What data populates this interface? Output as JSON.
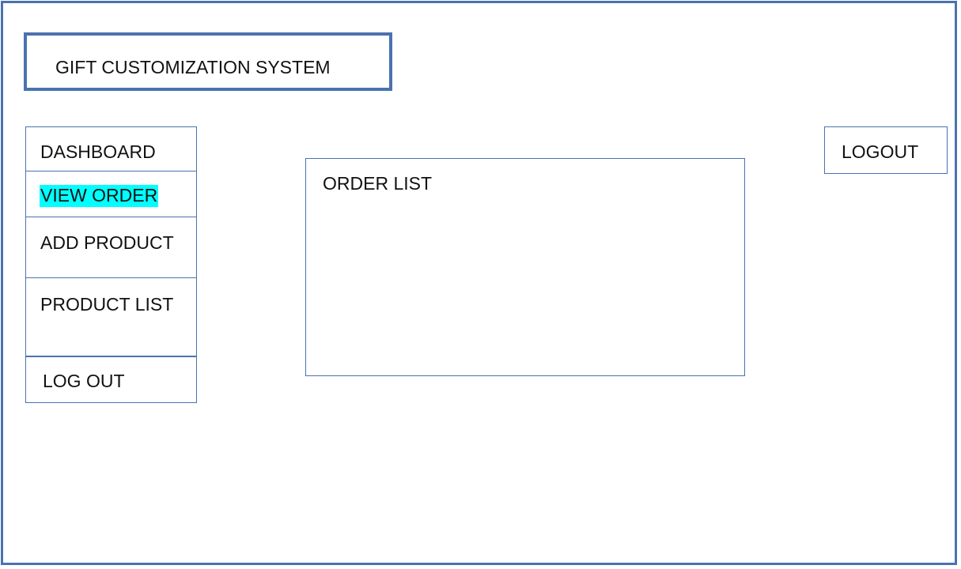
{
  "header": {
    "title": "GIFT CUSTOMIZATION SYSTEM"
  },
  "sidebar": {
    "items": [
      {
        "label": "DASHBOARD",
        "active": false
      },
      {
        "label": "VIEW ORDER",
        "active": true
      },
      {
        "label": "ADD PRODUCT",
        "active": false
      },
      {
        "label": "PRODUCT LIST",
        "active": false
      },
      {
        "label": "LOG OUT",
        "active": false
      }
    ]
  },
  "main": {
    "panel_title": "ORDER LIST"
  },
  "topbar": {
    "logout_label": "LOGOUT"
  },
  "colors": {
    "border": "#4a72b0",
    "active_highlight": "#00ffff",
    "text": "#111111",
    "background": "#ffffff"
  }
}
